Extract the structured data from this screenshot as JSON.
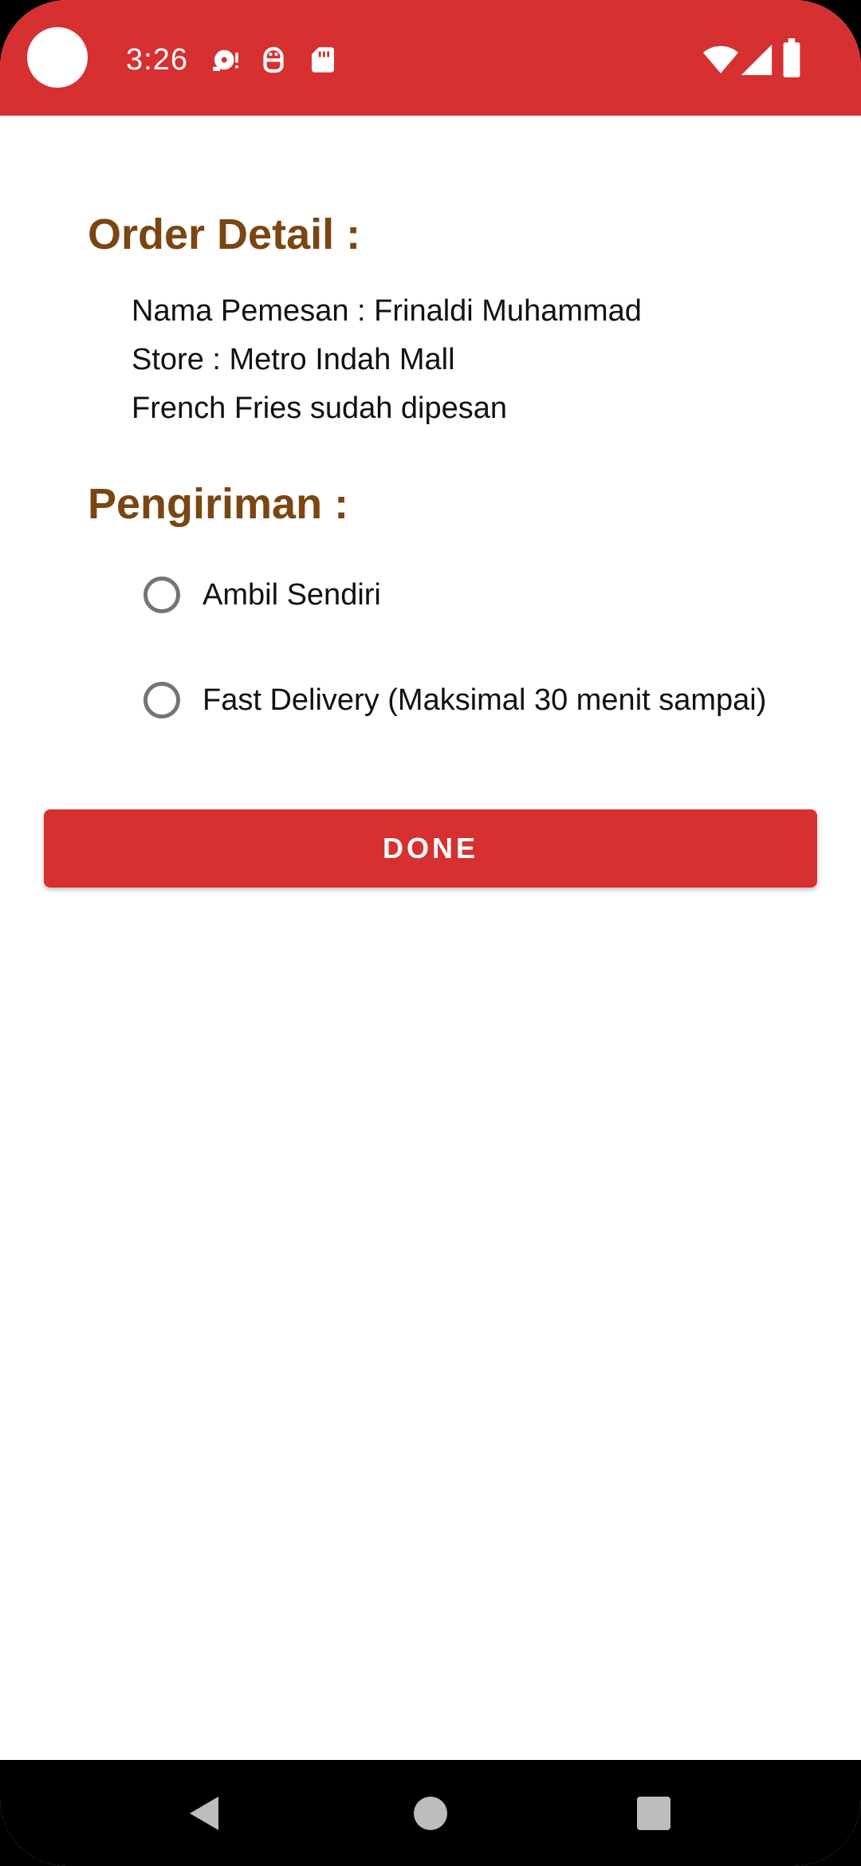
{
  "status_bar": {
    "time": "3:26",
    "background_color": "#d63031",
    "left_icons": [
      "camera-cutout",
      "media-playback-icon",
      "android-debug-icon",
      "sd-card-icon"
    ],
    "right_icons": [
      "wifi-icon",
      "cellular-signal-icon",
      "battery-icon"
    ]
  },
  "order_detail": {
    "title": "Order Detail :",
    "lines": [
      "Nama Pemesan : Frinaldi Muhammad",
      "Store : Metro Indah Mall",
      "French Fries sudah dipesan"
    ]
  },
  "shipping": {
    "title": "Pengiriman :",
    "options": [
      {
        "label": "Ambil Sendiri",
        "selected": false
      },
      {
        "label": "Fast Delivery (Maksimal 30 menit sampai)",
        "selected": false
      }
    ]
  },
  "done_button": {
    "label": "DONE",
    "color": "#d63031"
  },
  "title_color": "#7a4611",
  "nav_bar": {
    "buttons": [
      "back-icon",
      "home-icon",
      "recents-icon"
    ]
  }
}
